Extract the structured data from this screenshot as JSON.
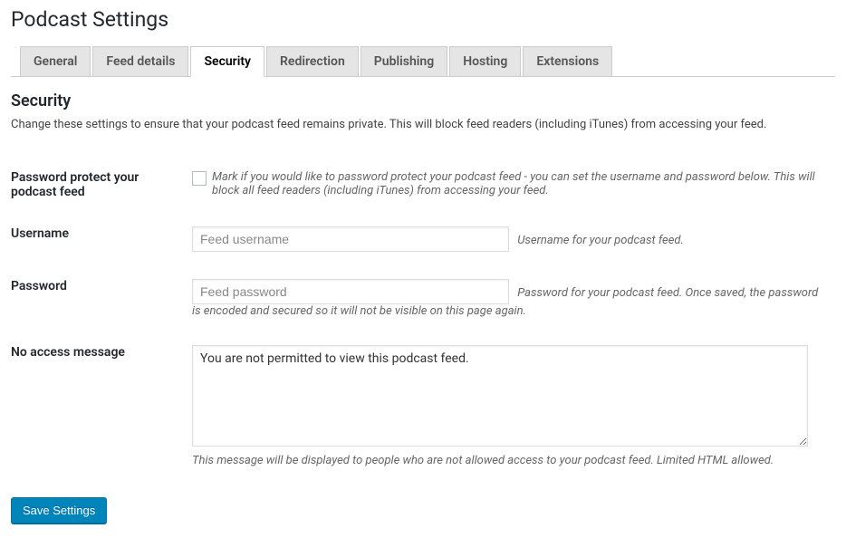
{
  "page": {
    "title": "Podcast Settings",
    "section_title": "Security",
    "section_description": "Change these settings to ensure that your podcast feed remains private. This will block feed readers (including iTunes) from accessing your feed."
  },
  "tabs": {
    "general": "General",
    "feed_details": "Feed details",
    "security": "Security",
    "redirection": "Redirection",
    "publishing": "Publishing",
    "hosting": "Hosting",
    "extensions": "Extensions"
  },
  "fields": {
    "password_protect": {
      "label": "Password protect your podcast feed",
      "description": "Mark if you would like to password protect your podcast feed - you can set the username and password below. This will block all feed readers (including iTunes) from accessing your feed."
    },
    "username": {
      "label": "Username",
      "placeholder": "Feed username",
      "value": "",
      "description": "Username for your podcast feed."
    },
    "password": {
      "label": "Password",
      "placeholder": "Feed password",
      "value": "",
      "description": "Password for your podcast feed. Once saved, the password is encoded and secured so it will not be visible on this page again."
    },
    "no_access": {
      "label": "No access message",
      "value": "You are not permitted to view this podcast feed.",
      "description": "This message will be displayed to people who are not allowed access to your podcast feed. Limited HTML allowed."
    }
  },
  "actions": {
    "save": "Save Settings"
  }
}
